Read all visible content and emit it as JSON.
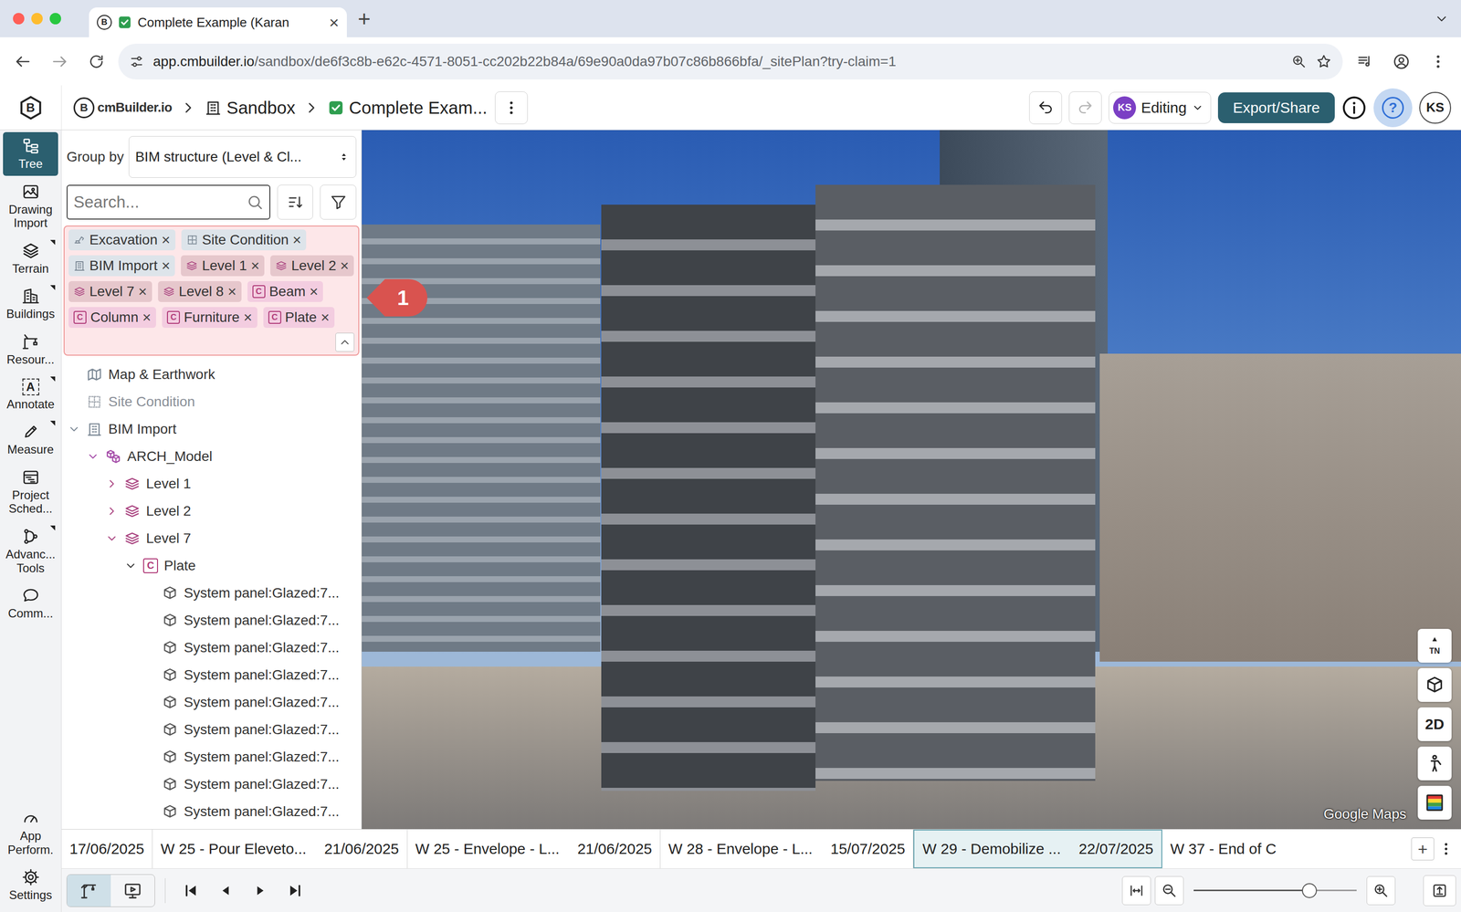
{
  "browser": {
    "favicon_glyph": "B",
    "tab_title": "Complete Example (Karan",
    "tab_close": "×",
    "new_tab": "+",
    "url_host": "app.cmbuilder.io",
    "url_path": "/sandbox/de6f3c8b-e62c-4571-8051-cc202b22b84a/69e90a0da97b07c86b866bfa/_sitePlan?try-claim=1"
  },
  "header": {
    "logo_glyph": "B",
    "brand_glyph": "B",
    "brand": "cmBuilder.io",
    "breadcrumbs": [
      "Sandbox",
      "Complete Exam..."
    ],
    "redo_enabled": false,
    "mode_avatar": "KS",
    "mode": "Editing",
    "export": "Export/Share",
    "help": "?",
    "help_selected": true,
    "user": "KS"
  },
  "rail": {
    "items": [
      {
        "label": "Tree",
        "selected": true,
        "has_menu": false
      },
      {
        "label": "Drawing Import",
        "selected": false,
        "has_menu": false
      },
      {
        "label": "Terrain",
        "selected": false,
        "has_menu": true
      },
      {
        "label": "Buildings",
        "selected": false,
        "has_menu": true
      },
      {
        "label": "Resour...",
        "selected": false,
        "has_menu": false
      },
      {
        "label": "Annotate",
        "selected": false,
        "has_menu": true,
        "glyph": "A"
      },
      {
        "label": "Measure",
        "selected": false,
        "has_menu": true
      },
      {
        "label": "Project Sched...",
        "selected": false,
        "has_menu": false
      },
      {
        "label": "Advanc... Tools",
        "selected": false,
        "has_menu": true
      },
      {
        "label": "Comm...",
        "selected": false,
        "has_menu": false
      }
    ],
    "footer": [
      {
        "label": "App Perform."
      },
      {
        "label": "Settings"
      }
    ]
  },
  "tree_panel": {
    "group_by_label": "Group by",
    "group_by_value": "BIM structure (Level & Cl...",
    "search_placeholder": "Search...",
    "class_glyph": "C",
    "remove_glyph": "×",
    "chips": [
      {
        "label": "Excavation",
        "kind": "excavation",
        "color": "#dde4ea"
      },
      {
        "label": "Site Condition",
        "kind": "site",
        "color": "#dde4ea"
      },
      {
        "label": "BIM Import",
        "kind": "bim",
        "color": "#dde4ea"
      },
      {
        "label": "Level 1",
        "kind": "level",
        "color": "#e6c7cc"
      },
      {
        "label": "Level 2",
        "kind": "level",
        "color": "#e6c7cc"
      },
      {
        "label": "Level 7",
        "kind": "level",
        "color": "#e6c7cc"
      },
      {
        "label": "Level 8",
        "kind": "level",
        "color": "#e6c7cc"
      },
      {
        "label": "Beam",
        "kind": "class",
        "color": "#f3cde0"
      },
      {
        "label": "Column",
        "kind": "class",
        "color": "#f3cde0"
      },
      {
        "label": "Furniture",
        "kind": "class",
        "color": "#f3cde0"
      },
      {
        "label": "Plate",
        "kind": "class",
        "color": "#f3cde0"
      }
    ],
    "rows": [
      {
        "label": "Map & Earthwork",
        "depth": 0,
        "kind": "map",
        "expandable": false,
        "expanded": false,
        "greyed": false
      },
      {
        "label": "Site Condition",
        "depth": 0,
        "kind": "site",
        "expandable": false,
        "expanded": false,
        "greyed": true
      },
      {
        "label": "BIM Import",
        "depth": 0,
        "kind": "bim",
        "expandable": true,
        "expanded": true,
        "greyed": false
      },
      {
        "label": "ARCH_Model",
        "depth": 1,
        "kind": "model",
        "expandable": true,
        "expanded": true,
        "greyed": false
      },
      {
        "label": "Level 1",
        "depth": 2,
        "kind": "level",
        "expandable": true,
        "expanded": false,
        "greyed": false
      },
      {
        "label": "Level 2",
        "depth": 2,
        "kind": "level",
        "expandable": true,
        "expanded": false,
        "greyed": false
      },
      {
        "label": "Level 7",
        "depth": 2,
        "kind": "level",
        "expandable": true,
        "expanded": true,
        "greyed": false
      },
      {
        "label": "Plate",
        "depth": 3,
        "kind": "class",
        "expandable": true,
        "expanded": true,
        "greyed": false
      },
      {
        "label": "System panel:Glazed:7...",
        "depth": 4,
        "kind": "element",
        "expandable": false,
        "expanded": false,
        "greyed": false
      },
      {
        "label": "System panel:Glazed:7...",
        "depth": 4,
        "kind": "element",
        "expandable": false,
        "expanded": false,
        "greyed": false
      },
      {
        "label": "System panel:Glazed:7...",
        "depth": 4,
        "kind": "element",
        "expandable": false,
        "expanded": false,
        "greyed": false
      },
      {
        "label": "System panel:Glazed:7...",
        "depth": 4,
        "kind": "element",
        "expandable": false,
        "expanded": false,
        "greyed": false
      },
      {
        "label": "System panel:Glazed:7...",
        "depth": 4,
        "kind": "element",
        "expandable": false,
        "expanded": false,
        "greyed": false
      },
      {
        "label": "System panel:Glazed:7...",
        "depth": 4,
        "kind": "element",
        "expandable": false,
        "expanded": false,
        "greyed": false
      },
      {
        "label": "System panel:Glazed:7...",
        "depth": 4,
        "kind": "element",
        "expandable": false,
        "expanded": false,
        "greyed": false
      },
      {
        "label": "System panel:Glazed:7...",
        "depth": 4,
        "kind": "element",
        "expandable": false,
        "expanded": false,
        "greyed": false
      },
      {
        "label": "System panel:Glazed:7...",
        "depth": 4,
        "kind": "element",
        "expandable": false,
        "expanded": false,
        "greyed": false
      }
    ]
  },
  "callout": {
    "label": "1"
  },
  "viewport": {
    "attribution": "Google Maps",
    "controls": [
      {
        "kind": "labeled-icon",
        "label": "TN"
      },
      {
        "kind": "icon"
      },
      {
        "kind": "text",
        "label": "2D"
      },
      {
        "kind": "icon"
      },
      {
        "kind": "icon"
      }
    ]
  },
  "timeline": {
    "entries": [
      {
        "date": "17/06/2025",
        "selected": false
      },
      {
        "label": "W 25 - Pour Eleveto...",
        "date": "21/06/2025",
        "selected": false
      },
      {
        "label": "W 25 - Envelope - L...",
        "date": "21/06/2025",
        "selected": false
      },
      {
        "label": "W 28 - Envelope - L...",
        "date": "15/07/2025",
        "selected": false
      },
      {
        "label": "W 29 - Demobilize ...",
        "date": "22/07/2025",
        "selected": true
      },
      {
        "label": "W 37 - End of C",
        "selected": false
      }
    ],
    "add": "+"
  },
  "toolbar": {
    "modes": [
      {
        "selected": true
      },
      {
        "selected": false
      }
    ],
    "zoom_level": 0.71
  }
}
